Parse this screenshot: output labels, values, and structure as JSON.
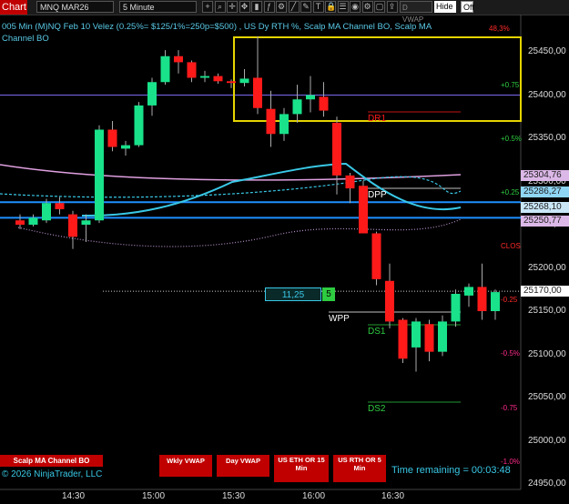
{
  "toolbar": {
    "chart_tab": "Chart",
    "instrument": "MNQ MAR26",
    "interval": "5 Minute",
    "icons": [
      "add-icon",
      "zoom-icon",
      "crosshair-icon",
      "pan-icon",
      "bar-style-icon",
      "indicators-icon",
      "strategy-icon",
      "line-icon",
      "draw-icon",
      "text-icon",
      "lock-icon",
      "properties-icon",
      "camera-icon",
      "settings-icon",
      "window-icon",
      "share-icon"
    ],
    "d_vwap": "D VWAP",
    "hide_label": "Hide",
    "off_label": "Off"
  },
  "chart_title": {
    "line1": "005 Min (M)NQ Feb 10 Velez (0.25%= $125/1%=250p=$500) , US Dy RTH %, Scalp MA Channel BO, Scalp MA",
    "line2": "Channel BO"
  },
  "price_axis": {
    "ticks": [
      "25450,00",
      "25400,00",
      "25350,00",
      "25300,00",
      "25250,00",
      "25200,00",
      "25150,00",
      "25100,00",
      "25050,00",
      "25000,00",
      "24950,00"
    ],
    "labels": [
      {
        "text": "25304,76",
        "bg": "#dcb8e8"
      },
      {
        "text": "25286,27",
        "bg": "#8fd6f5"
      },
      {
        "text": "25268,10",
        "bg": "#c9e7f7"
      },
      {
        "text": "25250,77",
        "bg": "#dcb8e8"
      },
      {
        "text": "25170,00",
        "bg": "#ffffff"
      }
    ]
  },
  "time_axis": [
    "14:30",
    "15:00",
    "15:30",
    "16:00",
    "16:30"
  ],
  "percent_levels": [
    {
      "text": "+0.75",
      "color": "#2ecc40"
    },
    {
      "text": "+0.5%",
      "color": "#2ecc40"
    },
    {
      "text": "+0.25",
      "color": "#2ecc40"
    },
    {
      "text": "CLOS",
      "color": "#ff2a2a"
    },
    {
      "text": "-0.25",
      "color": "#ff2a2a"
    },
    {
      "text": "-0.5%",
      "color": "#ff2a8a"
    },
    {
      "text": "-0.75",
      "color": "#ff2a8a"
    },
    {
      "text": "-1.0%",
      "color": "#ff2a8a"
    }
  ],
  "top_right_label": "48,3%",
  "levels": {
    "dr1": "DR1",
    "dpp": "DPP",
    "wpp": "WPP",
    "ds1": "DS1",
    "ds2": "DS2"
  },
  "position": {
    "value": "11,25",
    "qty": "5"
  },
  "bottom": {
    "scalp_button": "Scalp MA Channel BO",
    "copyright": "© 2026 NinjaTrader, LLC",
    "buttons": [
      "Wkly VWAP",
      "Day VWAP",
      "US ETH OR 15 Min",
      "US RTH OR 5 Min"
    ],
    "time_remaining": "Time remaining = 00:03:48"
  },
  "colors": {
    "bull": "#19e28a",
    "bear": "#ff1a1a",
    "cyan": "#39c8e6",
    "blue_line": "#1e8fff",
    "purple_line": "#7b68ee",
    "yellow_box": "#e5d400",
    "pink": "#e0a0e0"
  },
  "chart_data": {
    "type": "candlestick",
    "title": "005 Min (M)NQ Feb 10 Velez (0.25%= $125/1%=250p=$500) , US Dy RTH %, Scalp MA Channel BO, Scalp MA Channel BO",
    "ylim": [
      24950,
      25475
    ],
    "candles": [
      {
        "o": 25255,
        "h": 25262,
        "l": 25245,
        "c": 25250
      },
      {
        "o": 25250,
        "h": 25262,
        "l": 25248,
        "c": 25258
      },
      {
        "o": 25255,
        "h": 25280,
        "l": 25252,
        "c": 25275
      },
      {
        "o": 25275,
        "h": 25282,
        "l": 25262,
        "c": 25268
      },
      {
        "o": 25262,
        "h": 25266,
        "l": 25222,
        "c": 25236
      },
      {
        "o": 25250,
        "h": 25262,
        "l": 25230,
        "c": 25255
      },
      {
        "o": 25255,
        "h": 25365,
        "l": 25252,
        "c": 25360
      },
      {
        "o": 25360,
        "h": 25370,
        "l": 25335,
        "c": 25340
      },
      {
        "o": 25338,
        "h": 25347,
        "l": 25330,
        "c": 25342
      },
      {
        "o": 25342,
        "h": 25392,
        "l": 25340,
        "c": 25388
      },
      {
        "o": 25388,
        "h": 25420,
        "l": 25376,
        "c": 25415
      },
      {
        "o": 25415,
        "h": 25452,
        "l": 25412,
        "c": 25445
      },
      {
        "o": 25445,
        "h": 25452,
        "l": 25425,
        "c": 25438
      },
      {
        "o": 25438,
        "h": 25440,
        "l": 25415,
        "c": 25420
      },
      {
        "o": 25420,
        "h": 25428,
        "l": 25415,
        "c": 25422
      },
      {
        "o": 25422,
        "h": 25425,
        "l": 25413,
        "c": 25416
      },
      {
        "o": 25416,
        "h": 25418,
        "l": 25408,
        "c": 25414
      },
      {
        "o": 25414,
        "h": 25430,
        "l": 25410,
        "c": 25419
      },
      {
        "o": 25420,
        "h": 25468,
        "l": 25378,
        "c": 25385
      },
      {
        "o": 25384,
        "h": 25405,
        "l": 25340,
        "c": 25355
      },
      {
        "o": 25355,
        "h": 25385,
        "l": 25347,
        "c": 25378
      },
      {
        "o": 25378,
        "h": 25412,
        "l": 25368,
        "c": 25395
      },
      {
        "o": 25395,
        "h": 25422,
        "l": 25380,
        "c": 25400
      },
      {
        "o": 25398,
        "h": 25415,
        "l": 25375,
        "c": 25382
      },
      {
        "o": 25368,
        "h": 25375,
        "l": 25285,
        "c": 25307
      },
      {
        "o": 25307,
        "h": 25310,
        "l": 25275,
        "c": 25292
      },
      {
        "o": 25295,
        "h": 25301,
        "l": 25240,
        "c": 25240
      },
      {
        "o": 25240,
        "h": 25242,
        "l": 25180,
        "c": 25187
      },
      {
        "o": 25185,
        "h": 25205,
        "l": 25130,
        "c": 25138
      },
      {
        "o": 25140,
        "h": 25142,
        "l": 25090,
        "c": 25095
      },
      {
        "o": 25108,
        "h": 25142,
        "l": 25080,
        "c": 25138
      },
      {
        "o": 25135,
        "h": 25140,
        "l": 25092,
        "c": 25103
      },
      {
        "o": 25103,
        "h": 25145,
        "l": 25098,
        "c": 25138
      },
      {
        "o": 25138,
        "h": 25175,
        "l": 25132,
        "c": 25170
      },
      {
        "o": 25168,
        "h": 25182,
        "l": 25155,
        "c": 25178
      },
      {
        "o": 25178,
        "h": 25205,
        "l": 25140,
        "c": 25150
      },
      {
        "o": 25150,
        "h": 25175,
        "l": 25140,
        "c": 25172
      }
    ],
    "horizontal_levels": [
      {
        "name": "purple-level",
        "value": 25400
      },
      {
        "name": "blue-level-1",
        "value": 25276
      },
      {
        "name": "blue-level-2",
        "value": 25258
      },
      {
        "name": "dotted-white",
        "value": 25173
      }
    ]
  }
}
